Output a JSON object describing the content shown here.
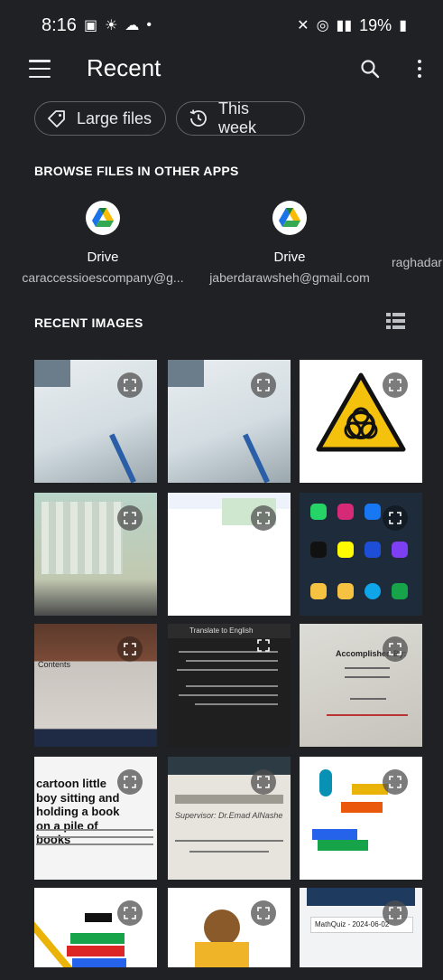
{
  "status_bar": {
    "time": "8:16",
    "battery": "19%"
  },
  "app_bar": {
    "title": "Recent"
  },
  "chips": [
    {
      "label": "Large files",
      "icon": "tag-icon"
    },
    {
      "label": "This week",
      "icon": "history-icon"
    }
  ],
  "browse_section": {
    "title": "BROWSE FILES IN OTHER APPS",
    "apps": [
      {
        "name": "Drive",
        "account": "caraccessioescompany@g...",
        "icon": "google-drive-icon"
      },
      {
        "name": "Drive",
        "account": "jaberdarawsheh@gmail.com",
        "icon": "google-drive-icon"
      },
      {
        "name": "",
        "account": "raghadar",
        "icon": ""
      }
    ]
  },
  "recent_images": {
    "title": "RECENT IMAGES",
    "thumbnails": [
      {
        "text": ""
      },
      {
        "text": ""
      },
      {
        "text": ""
      },
      {
        "text": ""
      },
      {
        "text": ""
      },
      {
        "text": ""
      },
      {
        "text": "Contents"
      },
      {
        "text": "Translate to English"
      },
      {
        "text": "Accomplished By:"
      },
      {
        "text": "cartoon little boy sitting and holding a book on a pile of books"
      },
      {
        "text": "Supervisor: Dr.Emad AlNashe"
      },
      {
        "text": ""
      },
      {
        "text": ""
      },
      {
        "text": ""
      },
      {
        "text": "MathQuiz - 2024-06-02"
      }
    ]
  },
  "colors": {
    "background": "#202124",
    "text": "#e8eaed",
    "chip_border": "#5f6368"
  }
}
